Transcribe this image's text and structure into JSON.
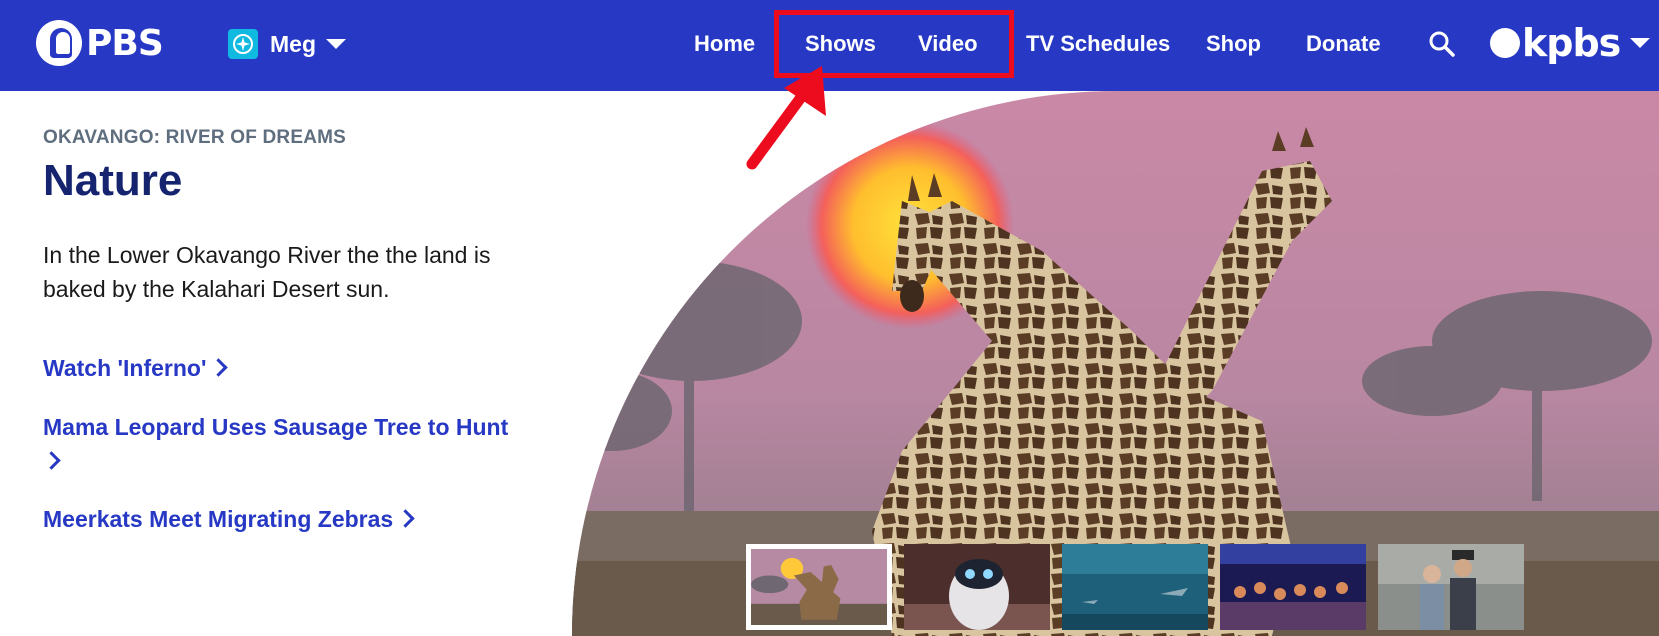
{
  "header": {
    "logo_text": "PBS",
    "user": {
      "name": "Meg",
      "badge_icon": "compass-icon"
    },
    "nav": [
      {
        "label": "Home"
      },
      {
        "label": "Shows"
      },
      {
        "label": "Video"
      },
      {
        "label": "TV Schedules"
      },
      {
        "label": "Shop"
      },
      {
        "label": "Donate"
      }
    ],
    "search_icon": "search-icon",
    "station_logo_text": "kpbs",
    "colors": {
      "background": "#2638c4",
      "annotation": "#ec0c1e",
      "user_badge": "#10b9e0"
    }
  },
  "feature": {
    "eyebrow": "OKAVANGO: RIVER OF DREAMS",
    "title": "Nature",
    "description": "In the Lower Okavango River the the land is baked by the Kalahari Desert sun.",
    "links": [
      {
        "label": "Watch 'Inferno'"
      },
      {
        "label": "Mama Leopard Uses Sausage Tree to Hunt"
      },
      {
        "label": "Meerkats Meet Migrating Zebras"
      }
    ]
  },
  "carousel": {
    "active_index": 0,
    "thumbnails": [
      "giraffes-sunset",
      "robot",
      "underwater-sharks",
      "stage-performance",
      "period-drama-couple"
    ]
  }
}
